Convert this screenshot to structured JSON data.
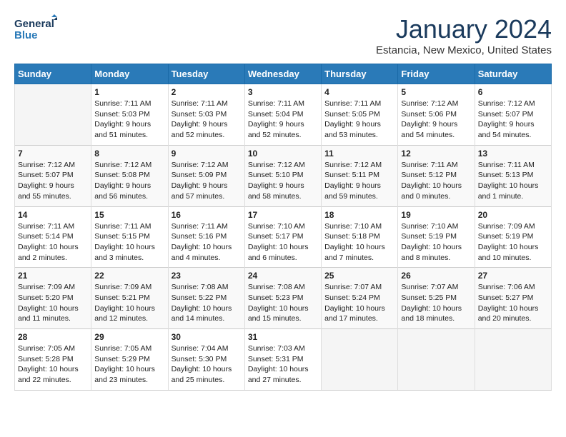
{
  "header": {
    "logo_line1": "General",
    "logo_line2": "Blue",
    "month": "January 2024",
    "location": "Estancia, New Mexico, United States"
  },
  "days_of_week": [
    "Sunday",
    "Monday",
    "Tuesday",
    "Wednesday",
    "Thursday",
    "Friday",
    "Saturday"
  ],
  "weeks": [
    [
      {
        "num": "",
        "sunrise": "",
        "sunset": "",
        "daylight": ""
      },
      {
        "num": "1",
        "sunrise": "Sunrise: 7:11 AM",
        "sunset": "Sunset: 5:03 PM",
        "daylight": "Daylight: 9 hours and 51 minutes."
      },
      {
        "num": "2",
        "sunrise": "Sunrise: 7:11 AM",
        "sunset": "Sunset: 5:03 PM",
        "daylight": "Daylight: 9 hours and 52 minutes."
      },
      {
        "num": "3",
        "sunrise": "Sunrise: 7:11 AM",
        "sunset": "Sunset: 5:04 PM",
        "daylight": "Daylight: 9 hours and 52 minutes."
      },
      {
        "num": "4",
        "sunrise": "Sunrise: 7:11 AM",
        "sunset": "Sunset: 5:05 PM",
        "daylight": "Daylight: 9 hours and 53 minutes."
      },
      {
        "num": "5",
        "sunrise": "Sunrise: 7:12 AM",
        "sunset": "Sunset: 5:06 PM",
        "daylight": "Daylight: 9 hours and 54 minutes."
      },
      {
        "num": "6",
        "sunrise": "Sunrise: 7:12 AM",
        "sunset": "Sunset: 5:07 PM",
        "daylight": "Daylight: 9 hours and 54 minutes."
      }
    ],
    [
      {
        "num": "7",
        "sunrise": "Sunrise: 7:12 AM",
        "sunset": "Sunset: 5:07 PM",
        "daylight": "Daylight: 9 hours and 55 minutes."
      },
      {
        "num": "8",
        "sunrise": "Sunrise: 7:12 AM",
        "sunset": "Sunset: 5:08 PM",
        "daylight": "Daylight: 9 hours and 56 minutes."
      },
      {
        "num": "9",
        "sunrise": "Sunrise: 7:12 AM",
        "sunset": "Sunset: 5:09 PM",
        "daylight": "Daylight: 9 hours and 57 minutes."
      },
      {
        "num": "10",
        "sunrise": "Sunrise: 7:12 AM",
        "sunset": "Sunset: 5:10 PM",
        "daylight": "Daylight: 9 hours and 58 minutes."
      },
      {
        "num": "11",
        "sunrise": "Sunrise: 7:12 AM",
        "sunset": "Sunset: 5:11 PM",
        "daylight": "Daylight: 9 hours and 59 minutes."
      },
      {
        "num": "12",
        "sunrise": "Sunrise: 7:11 AM",
        "sunset": "Sunset: 5:12 PM",
        "daylight": "Daylight: 10 hours and 0 minutes."
      },
      {
        "num": "13",
        "sunrise": "Sunrise: 7:11 AM",
        "sunset": "Sunset: 5:13 PM",
        "daylight": "Daylight: 10 hours and 1 minute."
      }
    ],
    [
      {
        "num": "14",
        "sunrise": "Sunrise: 7:11 AM",
        "sunset": "Sunset: 5:14 PM",
        "daylight": "Daylight: 10 hours and 2 minutes."
      },
      {
        "num": "15",
        "sunrise": "Sunrise: 7:11 AM",
        "sunset": "Sunset: 5:15 PM",
        "daylight": "Daylight: 10 hours and 3 minutes."
      },
      {
        "num": "16",
        "sunrise": "Sunrise: 7:11 AM",
        "sunset": "Sunset: 5:16 PM",
        "daylight": "Daylight: 10 hours and 4 minutes."
      },
      {
        "num": "17",
        "sunrise": "Sunrise: 7:10 AM",
        "sunset": "Sunset: 5:17 PM",
        "daylight": "Daylight: 10 hours and 6 minutes."
      },
      {
        "num": "18",
        "sunrise": "Sunrise: 7:10 AM",
        "sunset": "Sunset: 5:18 PM",
        "daylight": "Daylight: 10 hours and 7 minutes."
      },
      {
        "num": "19",
        "sunrise": "Sunrise: 7:10 AM",
        "sunset": "Sunset: 5:19 PM",
        "daylight": "Daylight: 10 hours and 8 minutes."
      },
      {
        "num": "20",
        "sunrise": "Sunrise: 7:09 AM",
        "sunset": "Sunset: 5:19 PM",
        "daylight": "Daylight: 10 hours and 10 minutes."
      }
    ],
    [
      {
        "num": "21",
        "sunrise": "Sunrise: 7:09 AM",
        "sunset": "Sunset: 5:20 PM",
        "daylight": "Daylight: 10 hours and 11 minutes."
      },
      {
        "num": "22",
        "sunrise": "Sunrise: 7:09 AM",
        "sunset": "Sunset: 5:21 PM",
        "daylight": "Daylight: 10 hours and 12 minutes."
      },
      {
        "num": "23",
        "sunrise": "Sunrise: 7:08 AM",
        "sunset": "Sunset: 5:22 PM",
        "daylight": "Daylight: 10 hours and 14 minutes."
      },
      {
        "num": "24",
        "sunrise": "Sunrise: 7:08 AM",
        "sunset": "Sunset: 5:23 PM",
        "daylight": "Daylight: 10 hours and 15 minutes."
      },
      {
        "num": "25",
        "sunrise": "Sunrise: 7:07 AM",
        "sunset": "Sunset: 5:24 PM",
        "daylight": "Daylight: 10 hours and 17 minutes."
      },
      {
        "num": "26",
        "sunrise": "Sunrise: 7:07 AM",
        "sunset": "Sunset: 5:25 PM",
        "daylight": "Daylight: 10 hours and 18 minutes."
      },
      {
        "num": "27",
        "sunrise": "Sunrise: 7:06 AM",
        "sunset": "Sunset: 5:27 PM",
        "daylight": "Daylight: 10 hours and 20 minutes."
      }
    ],
    [
      {
        "num": "28",
        "sunrise": "Sunrise: 7:05 AM",
        "sunset": "Sunset: 5:28 PM",
        "daylight": "Daylight: 10 hours and 22 minutes."
      },
      {
        "num": "29",
        "sunrise": "Sunrise: 7:05 AM",
        "sunset": "Sunset: 5:29 PM",
        "daylight": "Daylight: 10 hours and 23 minutes."
      },
      {
        "num": "30",
        "sunrise": "Sunrise: 7:04 AM",
        "sunset": "Sunset: 5:30 PM",
        "daylight": "Daylight: 10 hours and 25 minutes."
      },
      {
        "num": "31",
        "sunrise": "Sunrise: 7:03 AM",
        "sunset": "Sunset: 5:31 PM",
        "daylight": "Daylight: 10 hours and 27 minutes."
      },
      {
        "num": "",
        "sunrise": "",
        "sunset": "",
        "daylight": ""
      },
      {
        "num": "",
        "sunrise": "",
        "sunset": "",
        "daylight": ""
      },
      {
        "num": "",
        "sunrise": "",
        "sunset": "",
        "daylight": ""
      }
    ]
  ]
}
